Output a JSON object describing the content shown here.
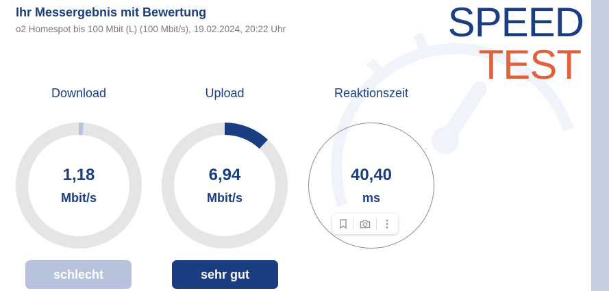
{
  "header": {
    "title": "Ihr Messergebnis mit Bewertung",
    "subtitle": "o2 Homespot bis 100 Mbit (L) (100 Mbit/s), 19.02.2024, 20:22 Uhr"
  },
  "logo": {
    "line1": "SPEED",
    "line2": "TEST"
  },
  "colors": {
    "primary": "#1b3d82",
    "accent": "#e2603a",
    "track": "#e5e5e5",
    "muted": "#b7c3dd"
  },
  "metrics": {
    "download": {
      "label": "Download",
      "value": "1,18",
      "unit": "Mbit/s",
      "fill": 0.0118,
      "rating": "schlecht"
    },
    "upload": {
      "label": "Upload",
      "value": "6,94",
      "unit": "Mbit/s",
      "fill": 0.12,
      "rating": "sehr gut"
    },
    "latency": {
      "label": "Reaktionszeit",
      "value": "40,40",
      "unit": "ms"
    }
  },
  "toolbar_icons": [
    "bookmark-icon",
    "camera-icon",
    "more-vertical-icon"
  ]
}
